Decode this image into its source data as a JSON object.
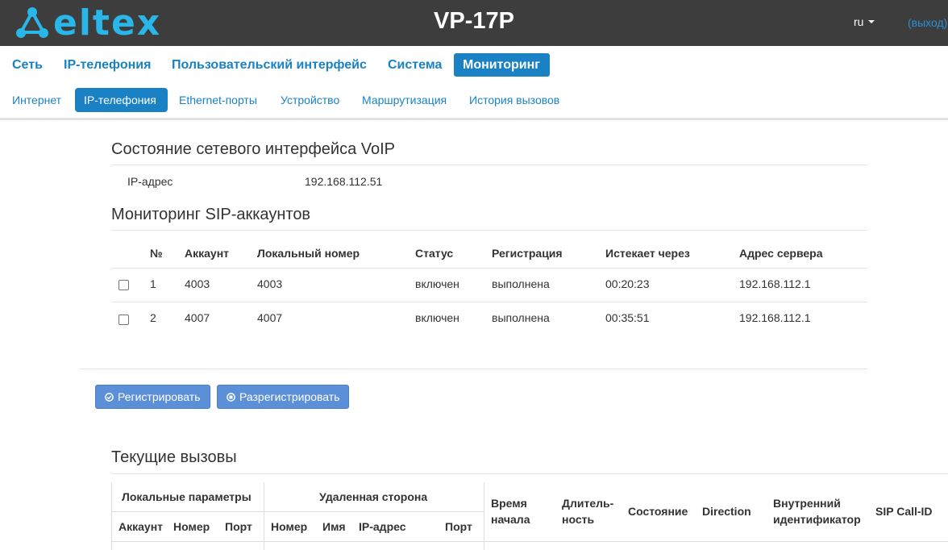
{
  "header": {
    "logo_text": "eltex",
    "device_title": "VP-17P",
    "lang": "ru",
    "logout": "(выход)"
  },
  "main_nav": [
    {
      "label": "Сеть",
      "active": false
    },
    {
      "label": "IP-телефония",
      "active": false
    },
    {
      "label": "Пользовательский интерфейс",
      "active": false
    },
    {
      "label": "Система",
      "active": false
    },
    {
      "label": "Мониторинг",
      "active": true
    }
  ],
  "sub_nav": [
    {
      "label": "Интернет",
      "active": false
    },
    {
      "label": "IP-телефония",
      "active": true
    },
    {
      "label": "Ethernet-порты",
      "active": false
    },
    {
      "label": "Устройство",
      "active": false
    },
    {
      "label": "Маршрутизация",
      "active": false
    },
    {
      "label": "История вызовов",
      "active": false
    }
  ],
  "voip_status": {
    "title": "Состояние сетевого интерфейса VoIP",
    "ip_label": "IP-адрес",
    "ip_value": "192.168.112.51"
  },
  "sip_monitoring": {
    "title": "Мониторинг SIP-аккаунтов",
    "columns": [
      "№",
      "Аккаунт",
      "Локальный номер",
      "Статус",
      "Регистрация",
      "Истекает через",
      "Адрес сервера"
    ],
    "rows": [
      {
        "checked": false,
        "num": "1",
        "account": "4003",
        "local_number": "4003",
        "status": "включен",
        "registration": "выполнена",
        "expires": "00:20:23",
        "server": "192.168.112.1"
      },
      {
        "checked": false,
        "num": "2",
        "account": "4007",
        "local_number": "4007",
        "status": "включен",
        "registration": "выполнена",
        "expires": "00:35:51",
        "server": "192.168.112.1"
      }
    ]
  },
  "actions": {
    "register": "Регистрировать",
    "unregister": "Разрегистрировать"
  },
  "current_calls": {
    "title": "Текущие вызовы",
    "group_local": "Локальные параметры",
    "group_remote": "Удаленная сторона",
    "col_account": "Аккаунт",
    "col_number": "Номер",
    "col_port": "Порт",
    "col_remote_number": "Номер",
    "col_name": "Имя",
    "col_ip": "IP-адрес",
    "col_remote_port": "Порт",
    "col_start_line1": "Время",
    "col_start_line2": "начала",
    "col_duration_line1": "Длитель-",
    "col_duration_line2": "ность",
    "col_state": "Состояние",
    "col_direction": "Direction",
    "col_internal_line1": "Внутренний",
    "col_internal_line2": "идентификатор",
    "col_callid": "SIP Call-ID"
  },
  "colors": {
    "header_bg": "#3d3d3d",
    "brand": "#29b6e8",
    "link": "#1a82c4",
    "button": "#5b8fd7"
  }
}
